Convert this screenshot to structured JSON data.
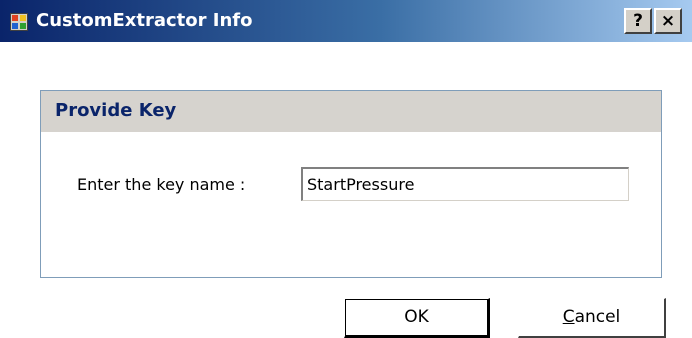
{
  "window": {
    "title": "CustomExtractor Info",
    "help_button": "?",
    "close_button": "×"
  },
  "group": {
    "title": "Provide Key",
    "label": "Enter the key name :",
    "input_value": "StartPressure"
  },
  "buttons": {
    "ok_label": "OK",
    "cancel_mnemonic": "C",
    "cancel_rest": "ancel"
  },
  "colors": {
    "titlebar_start": "#0a246a",
    "titlebar_end": "#a6caf0",
    "group_header": "#d6d3ce",
    "group_title": "#0a246a"
  }
}
